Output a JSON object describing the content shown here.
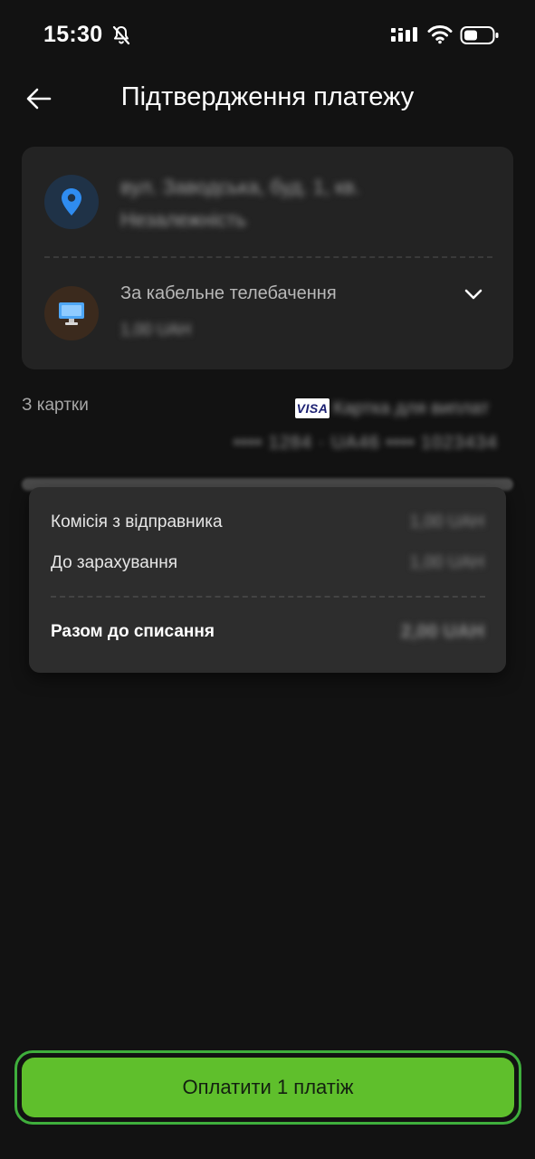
{
  "status_bar": {
    "time": "15:30"
  },
  "header": {
    "title": "Підтвердження платежу"
  },
  "payment": {
    "address_line1": "вул. Заводська, буд. 1, кв.",
    "address_line2": "Незалежність",
    "service_name": "За кабельне телебачення",
    "service_amount": "1,00 UAH"
  },
  "source_card": {
    "label": "З картки",
    "brand": "VISA",
    "name": "Картка для виплат",
    "number": "•••• 1284 · UA46 •••• 1023434"
  },
  "fees": {
    "commission_label": "Комісія з відправника",
    "commission_value": "1,00 UAH",
    "credit_label": "До зарахування",
    "credit_value": "1,00 UAH",
    "total_label": "Разом до списання",
    "total_value": "2,00 UAH"
  },
  "actions": {
    "pay_label": "Оплатити 1 платіж"
  },
  "colors": {
    "background": "#121212",
    "card": "#232323",
    "popover": "#2d2d2d",
    "accent_green": "#5fbf2c",
    "pin_blue": "#2f8cf0"
  },
  "icons": {
    "status": [
      "bell-off-icon",
      "signal-icon",
      "wifi-icon",
      "battery-icon"
    ],
    "header": "arrow-left-icon",
    "address": "location-pin-icon",
    "service": "monitor-icon",
    "expand": "chevron-down-icon"
  }
}
